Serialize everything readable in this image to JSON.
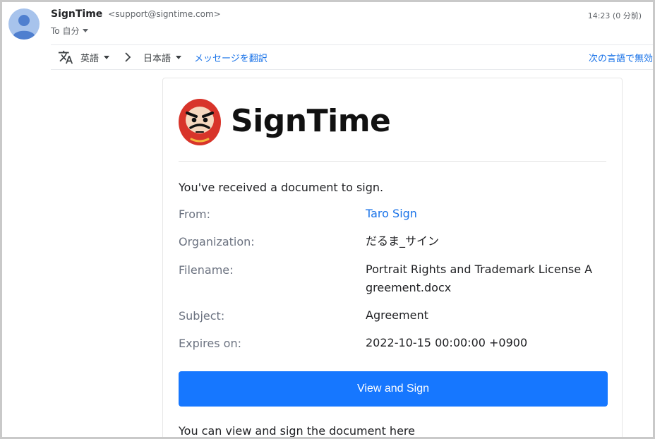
{
  "header": {
    "sender_name": "SignTime",
    "sender_email": "<support@signtime.com>",
    "to_label": "To 自分",
    "timestamp": "14:23 (0 分前)"
  },
  "translate_bar": {
    "source_lang": "英語",
    "target_lang": "日本語",
    "translate_link": "メッセージを翻訳",
    "never_translate": "次の言語で無効"
  },
  "email": {
    "brand": "SignTime",
    "intro": "You've received a document to sign.",
    "fields": [
      {
        "label": "From:",
        "value": "Taro Sign"
      },
      {
        "label": "Organization:",
        "value": "だるま_サイン"
      },
      {
        "label": "Filename:",
        "value": "Portrait Rights and Trademark License Agreement.docx"
      },
      {
        "label": "Subject:",
        "value": "Agreement"
      },
      {
        "label": "Expires on:",
        "value": "2022-10-15 00:00:00 +0900"
      }
    ],
    "cta_label": "View and Sign",
    "footer": "You can view and sign the document here"
  },
  "colors": {
    "accent": "#1677ff",
    "link": "#1a73e8",
    "logo_red": "#d8342a"
  }
}
